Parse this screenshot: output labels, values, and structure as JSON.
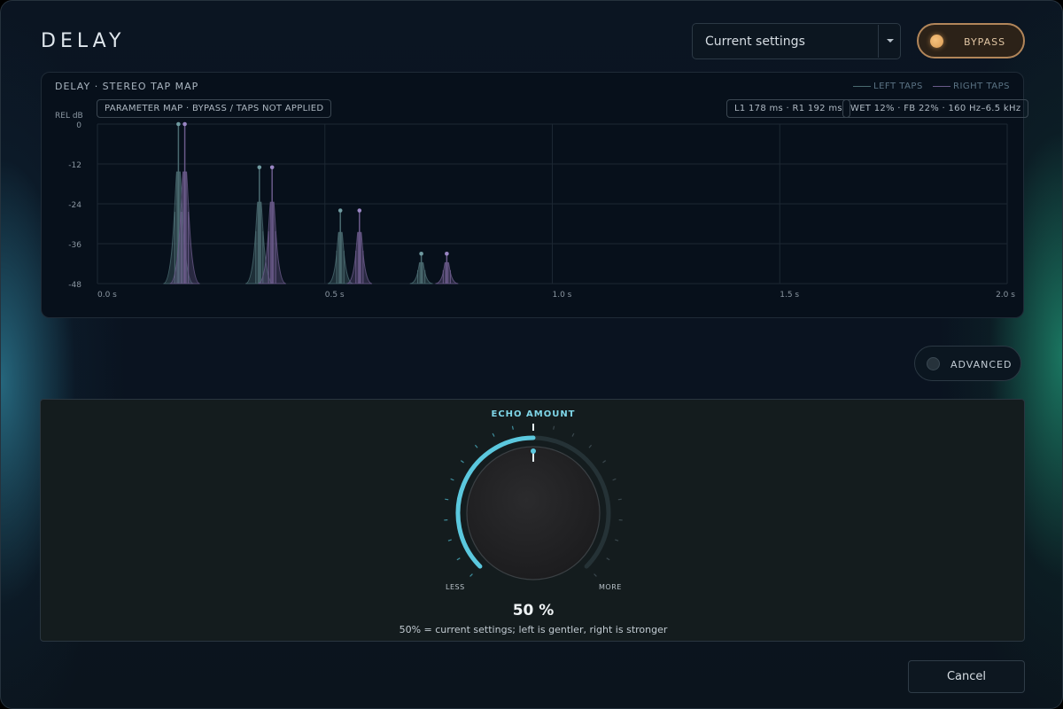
{
  "app": {
    "title": "DELAY"
  },
  "preset": {
    "value": "Current settings"
  },
  "bypass": {
    "label": "BYPASS"
  },
  "tapmap": {
    "header": "DELAY · STEREO TAP MAP",
    "legend_left": "LEFT TAPS",
    "legend_right": "RIGHT TAPS",
    "param_pill": "PARAMETER MAP · BYPASS / TAPS NOT APPLIED",
    "taps_pill": "L1 178 ms · R1 192 ms",
    "wet_pill": "WET 12% · FB 22% · 160 Hz–6.5 kHz"
  },
  "chart_data": {
    "type": "line",
    "ylabel": "REL dB",
    "ylim": [
      -48,
      0
    ],
    "xlim": [
      0,
      2.0
    ],
    "yticks": [
      "0",
      "-12",
      "-24",
      "-36",
      "-48"
    ],
    "xticks": [
      "0.0 s",
      "0.5 s",
      "1.0 s",
      "1.5 s",
      "2.0 s"
    ],
    "grid": true,
    "legend": "top-right",
    "series": [
      {
        "name": "LEFT TAPS",
        "color": "#4a6a70",
        "taps": [
          {
            "t": 0.178,
            "db": 0
          },
          {
            "t": 0.356,
            "db": -13
          },
          {
            "t": 0.534,
            "db": -26
          },
          {
            "t": 0.712,
            "db": -39
          }
        ]
      },
      {
        "name": "RIGHT TAPS",
        "color": "#6a5a8a",
        "taps": [
          {
            "t": 0.192,
            "db": 0
          },
          {
            "t": 0.384,
            "db": -13
          },
          {
            "t": 0.576,
            "db": -26
          },
          {
            "t": 0.768,
            "db": -39
          }
        ]
      }
    ]
  },
  "advanced": {
    "label": "ADVANCED"
  },
  "echo": {
    "label": "ECHO AMOUNT",
    "value": 50,
    "value_text": "50 %",
    "less": "LESS",
    "more": "MORE",
    "hint": "50% = current settings; left is gentler, right is stronger",
    "accent": "#5bc8de"
  },
  "footer": {
    "cancel_label": "Cancel"
  }
}
